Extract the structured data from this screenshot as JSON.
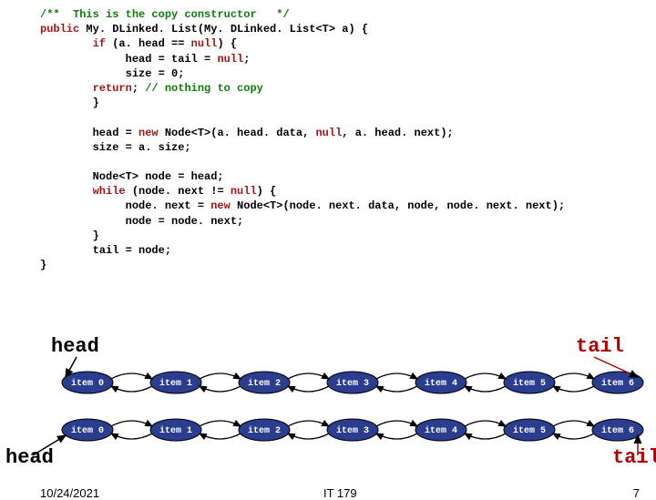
{
  "code": {
    "l1_a": "/**  ",
    "l1_b": "This is the copy constructor",
    "l1_c": "   */",
    "l2_a": "public ",
    "l2_b": "My. DLinked. List(My. DLinked. List<T> a) {",
    "l3_a": "        if ",
    "l3_b": "(a. head == ",
    "l3_c": "null",
    "l3_d": ") {",
    "l4_a": "             head = tail = ",
    "l4_b": "null",
    "l4_c": ";",
    "l5_a": "             size = 0;",
    "l6_a": "        return",
    "l6_b": "; ",
    "l6_c": "// nothing to copy",
    "l7_a": "        }",
    "l8_a": "        head = ",
    "l8_b": "new ",
    "l8_c": "Node<T>(a. head. data, ",
    "l8_d": "null",
    "l8_e": ", a. head. next);",
    "l9_a": "        size = a. size;",
    "l10_a": "        Node<T> node = head;",
    "l11_a": "        while ",
    "l11_b": "(node. next != ",
    "l11_c": "null",
    "l11_d": ") {",
    "l12_a": "             node. next = ",
    "l12_b": "new ",
    "l12_c": "Node<T>(node. next. data, node, node. next. next);",
    "l13_a": "             node = node. next;",
    "l14_a": "        }",
    "l15_a": "        tail = node;",
    "l16_a": "}"
  },
  "labels": {
    "head_top": "head",
    "tail_top": "tail",
    "head_bot": "head",
    "tail_bot": "tail"
  },
  "nodes_row1": [
    "item 0",
    "item 1",
    "item 2",
    "item 3",
    "item 4",
    "item 5",
    "item 6"
  ],
  "nodes_row2": [
    "item 0",
    "item 1",
    "item 2",
    "item 3",
    "item 4",
    "item 5",
    "item 6"
  ],
  "footer": {
    "date": "10/24/2021",
    "course": "IT 179",
    "page": "7"
  }
}
